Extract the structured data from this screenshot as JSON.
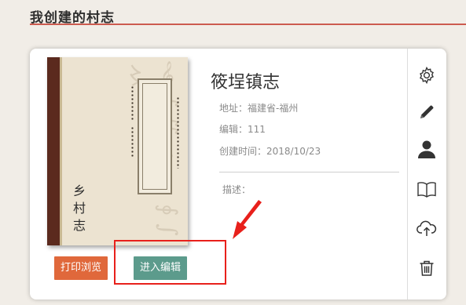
{
  "section": {
    "title": "我创建的村志"
  },
  "book": {
    "cover_title": [
      "乡",
      "村",
      "志"
    ]
  },
  "info": {
    "title": "筱埕镇志",
    "address": "地址：福建省-福州",
    "editor": "编辑：111",
    "created": "创建时间：2018/10/23",
    "description_label": "描述："
  },
  "buttons": {
    "print_preview": "打印浏览",
    "enter_edit": "进入编辑"
  },
  "actions": [
    "gear-icon",
    "pencil-icon",
    "user-icon",
    "book-icon",
    "cloud-upload-icon",
    "trash-icon"
  ],
  "colors": {
    "title_rule": "#cc5b4f",
    "print_button": "#e0683b",
    "edit_button": "#5c9b8c",
    "annotation": "#e8201b"
  }
}
